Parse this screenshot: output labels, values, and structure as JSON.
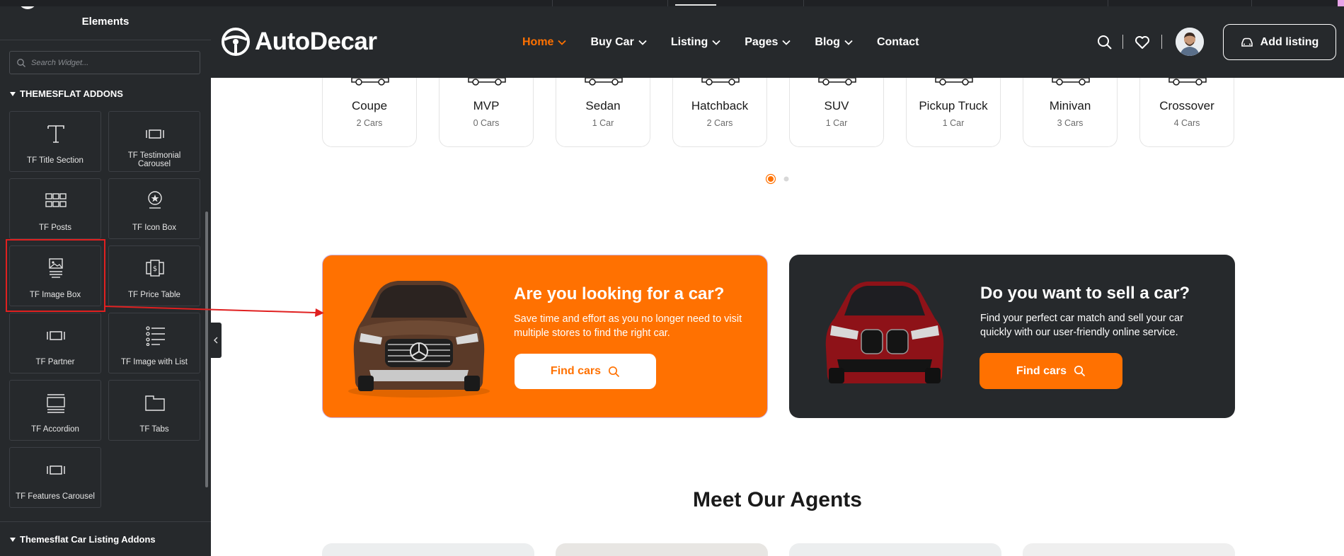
{
  "panel": {
    "title": "Elements",
    "search_placeholder": "Search Widget...",
    "category_1": "THEMESFLAT ADDONS",
    "category_2": "Themesflat Car Listing Addons",
    "widgets": [
      {
        "label": "TF Title Section",
        "icon": "title-icon"
      },
      {
        "label": "TF Testimonial Carousel",
        "icon": "carousel-icon"
      },
      {
        "label": "TF Posts",
        "icon": "grid-icon"
      },
      {
        "label": "TF Icon Box",
        "icon": "icon-box-icon"
      },
      {
        "label": "TF Image Box",
        "icon": "image-box-icon"
      },
      {
        "label": "TF Price Table",
        "icon": "price-table-icon"
      },
      {
        "label": "TF Partner",
        "icon": "carousel-icon"
      },
      {
        "label": "TF Image with List",
        "icon": "list-icon"
      },
      {
        "label": "TF Accordion",
        "icon": "accordion-icon"
      },
      {
        "label": "TF Tabs",
        "icon": "tabs-icon"
      },
      {
        "label": "TF Features Carousel",
        "icon": "carousel-icon"
      }
    ]
  },
  "header": {
    "logo_text": "AutoDecar",
    "nav": [
      {
        "label": "Home",
        "has_dropdown": true,
        "active": true
      },
      {
        "label": "Buy Car",
        "has_dropdown": true
      },
      {
        "label": "Listing",
        "has_dropdown": true
      },
      {
        "label": "Pages",
        "has_dropdown": true
      },
      {
        "label": "Blog",
        "has_dropdown": true
      },
      {
        "label": "Contact",
        "has_dropdown": false
      }
    ],
    "add_listing_label": "Add listing"
  },
  "categories": [
    {
      "name": "Coupe",
      "count": "2 Cars"
    },
    {
      "name": "MVP",
      "count": "0 Cars"
    },
    {
      "name": "Sedan",
      "count": "1 Car"
    },
    {
      "name": "Hatchback",
      "count": "2 Cars"
    },
    {
      "name": "SUV",
      "count": "1 Car"
    },
    {
      "name": "Pickup Truck",
      "count": "1 Car"
    },
    {
      "name": "Minivan",
      "count": "3 Cars"
    },
    {
      "name": "Crossover",
      "count": "4 Cars"
    }
  ],
  "promo_buy": {
    "title": "Are you looking for a car?",
    "text": "Save time and effort as you no longer need to visit multiple stores to find the right car.",
    "button": "Find cars"
  },
  "promo_sell": {
    "title": "Do you want to sell a car?",
    "text": "Find your perfect car match and sell your car quickly with our user-friendly online service.",
    "button": "Find cars"
  },
  "agents_title": "Meet Our Agents",
  "colors": {
    "accent": "#ff7101",
    "dark": "#26292c",
    "highlight": "#e02020"
  }
}
